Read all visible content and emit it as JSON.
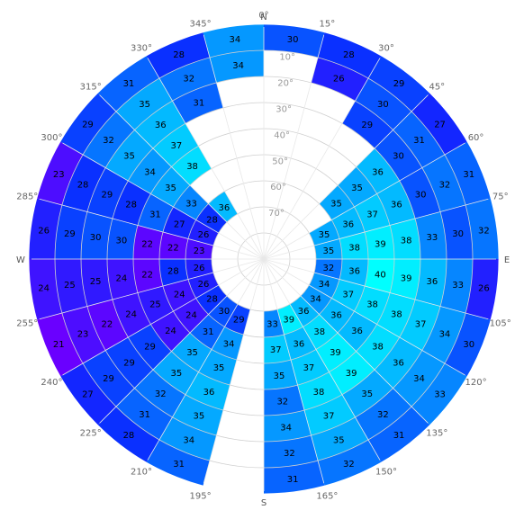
{
  "chart_data": {
    "type": "heatmap",
    "projection": "polar",
    "azimuth_step_deg": 15,
    "elevation_step_deg": 10,
    "compass_labels": {
      "N": "N",
      "E": "E",
      "S": "S",
      "W": "W"
    },
    "azimuth_labels": [
      "0°",
      "15°",
      "30°",
      "45°",
      "60°",
      "75°",
      "105°",
      "120°",
      "135°",
      "150°",
      "165°",
      "195°",
      "210°",
      "225°",
      "240°",
      "255°",
      "285°",
      "300°",
      "315°",
      "330°",
      "345°"
    ],
    "elevation_labels": [
      "10°",
      "20°",
      "30°",
      "40°",
      "50°",
      "60°",
      "70°"
    ],
    "colors": {
      "low": "#6a00ff",
      "mid": "#0a2aff",
      "high": "#00ffff"
    },
    "value_range": [
      21,
      40
    ],
    "obstructed_cells": [
      {
        "az": 0,
        "el": 10
      },
      {
        "az": 0,
        "el": 20
      },
      {
        "az": 0,
        "el": 30
      },
      {
        "az": 0,
        "el": 40
      },
      {
        "az": 0,
        "el": 50
      },
      {
        "az": 0,
        "el": 60
      },
      {
        "az": 15,
        "el": 20
      },
      {
        "az": 15,
        "el": 30
      },
      {
        "az": 15,
        "el": 40
      },
      {
        "az": 15,
        "el": 50
      },
      {
        "az": 15,
        "el": 60
      },
      {
        "az": 30,
        "el": 40
      },
      {
        "az": 30,
        "el": 50
      },
      {
        "az": 30,
        "el": 60
      },
      {
        "az": 315,
        "el": 50
      },
      {
        "az": 315,
        "el": 60
      },
      {
        "az": 330,
        "el": 30
      },
      {
        "az": 330,
        "el": 40
      },
      {
        "az": 330,
        "el": 50
      },
      {
        "az": 330,
        "el": 60
      },
      {
        "az": 345,
        "el": 20
      },
      {
        "az": 345,
        "el": 30
      },
      {
        "az": 345,
        "el": 40
      },
      {
        "az": 345,
        "el": 50
      },
      {
        "az": 345,
        "el": 60
      }
    ],
    "cells": [
      {
        "az": 0,
        "el": 0,
        "v": 30
      },
      {
        "az": 15,
        "el": 0,
        "v": 28
      },
      {
        "az": 15,
        "el": 10,
        "v": 26
      },
      {
        "az": 30,
        "el": 0,
        "v": 29
      },
      {
        "az": 30,
        "el": 10,
        "v": 30
      },
      {
        "az": 30,
        "el": 20,
        "v": 29
      },
      {
        "az": 45,
        "el": 0,
        "v": 27
      },
      {
        "az": 45,
        "el": 10,
        "v": 31
      },
      {
        "az": 45,
        "el": 20,
        "v": 30
      },
      {
        "az": 45,
        "el": 30,
        "v": 36
      },
      {
        "az": 45,
        "el": 40,
        "v": 35
      },
      {
        "az": 45,
        "el": 50,
        "v": 35
      },
      {
        "az": 60,
        "el": 0,
        "v": 31
      },
      {
        "az": 60,
        "el": 10,
        "v": 32
      },
      {
        "az": 60,
        "el": 20,
        "v": 30
      },
      {
        "az": 60,
        "el": 30,
        "v": 36
      },
      {
        "az": 60,
        "el": 40,
        "v": 37
      },
      {
        "az": 60,
        "el": 50,
        "v": 36
      },
      {
        "az": 60,
        "el": 60,
        "v": 35
      },
      {
        "az": 75,
        "el": 0,
        "v": 32
      },
      {
        "az": 75,
        "el": 10,
        "v": 30
      },
      {
        "az": 75,
        "el": 20,
        "v": 33
      },
      {
        "az": 75,
        "el": 30,
        "v": 38
      },
      {
        "az": 75,
        "el": 40,
        "v": 39
      },
      {
        "az": 75,
        "el": 50,
        "v": 38
      },
      {
        "az": 75,
        "el": 60,
        "v": 35
      },
      {
        "az": 90,
        "el": 0,
        "v": 26
      },
      {
        "az": 90,
        "el": 10,
        "v": 33
      },
      {
        "az": 90,
        "el": 20,
        "v": 36
      },
      {
        "az": 90,
        "el": 30,
        "v": 39
      },
      {
        "az": 90,
        "el": 40,
        "v": 40
      },
      {
        "az": 90,
        "el": 50,
        "v": 36
      },
      {
        "az": 90,
        "el": 60,
        "v": 32
      },
      {
        "az": 105,
        "el": 0,
        "v": 30
      },
      {
        "az": 105,
        "el": 10,
        "v": 34
      },
      {
        "az": 105,
        "el": 20,
        "v": 37
      },
      {
        "az": 105,
        "el": 30,
        "v": 38
      },
      {
        "az": 105,
        "el": 40,
        "v": 38
      },
      {
        "az": 105,
        "el": 50,
        "v": 37
      },
      {
        "az": 105,
        "el": 60,
        "v": 34
      },
      {
        "az": 120,
        "el": 0,
        "v": 33
      },
      {
        "az": 120,
        "el": 10,
        "v": 34
      },
      {
        "az": 120,
        "el": 20,
        "v": 36
      },
      {
        "az": 120,
        "el": 30,
        "v": 38
      },
      {
        "az": 120,
        "el": 40,
        "v": 36
      },
      {
        "az": 120,
        "el": 50,
        "v": 36
      },
      {
        "az": 120,
        "el": 60,
        "v": 34
      },
      {
        "az": 135,
        "el": 0,
        "v": 31
      },
      {
        "az": 135,
        "el": 10,
        "v": 32
      },
      {
        "az": 135,
        "el": 20,
        "v": 35
      },
      {
        "az": 135,
        "el": 30,
        "v": 39
      },
      {
        "az": 135,
        "el": 40,
        "v": 39
      },
      {
        "az": 135,
        "el": 50,
        "v": 38
      },
      {
        "az": 135,
        "el": 60,
        "v": 36
      },
      {
        "az": 150,
        "el": 0,
        "v": 32
      },
      {
        "az": 150,
        "el": 10,
        "v": 35
      },
      {
        "az": 150,
        "el": 20,
        "v": 37
      },
      {
        "az": 150,
        "el": 30,
        "v": 38
      },
      {
        "az": 150,
        "el": 40,
        "v": 37
      },
      {
        "az": 150,
        "el": 50,
        "v": 36
      },
      {
        "az": 150,
        "el": 60,
        "v": 39
      },
      {
        "az": 165,
        "el": 0,
        "v": 31
      },
      {
        "az": 165,
        "el": 10,
        "v": 32
      },
      {
        "az": 165,
        "el": 20,
        "v": 34
      },
      {
        "az": 165,
        "el": 30,
        "v": 32
      },
      {
        "az": 165,
        "el": 40,
        "v": 35
      },
      {
        "az": 165,
        "el": 50,
        "v": 37
      },
      {
        "az": 165,
        "el": 60,
        "v": 33
      },
      {
        "az": 195,
        "el": 0,
        "v": 31
      },
      {
        "az": 195,
        "el": 10,
        "v": 34
      },
      {
        "az": 195,
        "el": 20,
        "v": 35
      },
      {
        "az": 195,
        "el": 30,
        "v": 36
      },
      {
        "az": 195,
        "el": 40,
        "v": 35
      },
      {
        "az": 195,
        "el": 50,
        "v": 34
      },
      {
        "az": 195,
        "el": 60,
        "v": 29
      },
      {
        "az": 210,
        "el": 0,
        "v": 28
      },
      {
        "az": 210,
        "el": 10,
        "v": 31
      },
      {
        "az": 210,
        "el": 20,
        "v": 32
      },
      {
        "az": 210,
        "el": 30,
        "v": 35
      },
      {
        "az": 210,
        "el": 40,
        "v": 35
      },
      {
        "az": 210,
        "el": 50,
        "v": 31
      },
      {
        "az": 210,
        "el": 60,
        "v": 30
      },
      {
        "az": 225,
        "el": 0,
        "v": 27
      },
      {
        "az": 225,
        "el": 10,
        "v": 29
      },
      {
        "az": 225,
        "el": 20,
        "v": 29
      },
      {
        "az": 225,
        "el": 30,
        "v": 29
      },
      {
        "az": 225,
        "el": 40,
        "v": 24
      },
      {
        "az": 225,
        "el": 50,
        "v": 24
      },
      {
        "az": 225,
        "el": 60,
        "v": 28
      },
      {
        "az": 240,
        "el": 0,
        "v": 21
      },
      {
        "az": 240,
        "el": 10,
        "v": 23
      },
      {
        "az": 240,
        "el": 20,
        "v": 22
      },
      {
        "az": 240,
        "el": 30,
        "v": 24
      },
      {
        "az": 240,
        "el": 40,
        "v": 25
      },
      {
        "az": 240,
        "el": 50,
        "v": 24
      },
      {
        "az": 240,
        "el": 60,
        "v": 26
      },
      {
        "az": 255,
        "el": 0,
        "v": 24
      },
      {
        "az": 255,
        "el": 10,
        "v": 25
      },
      {
        "az": 255,
        "el": 20,
        "v": 25
      },
      {
        "az": 255,
        "el": 30,
        "v": 24
      },
      {
        "az": 255,
        "el": 40,
        "v": 22
      },
      {
        "az": 255,
        "el": 50,
        "v": 28
      },
      {
        "az": 255,
        "el": 60,
        "v": 26
      },
      {
        "az": 270,
        "el": 0,
        "v": 26
      },
      {
        "az": 270,
        "el": 10,
        "v": 29
      },
      {
        "az": 270,
        "el": 20,
        "v": 30
      },
      {
        "az": 270,
        "el": 30,
        "v": 30
      },
      {
        "az": 270,
        "el": 40,
        "v": 22
      },
      {
        "az": 270,
        "el": 50,
        "v": 22
      },
      {
        "az": 270,
        "el": 60,
        "v": 23
      },
      {
        "az": 285,
        "el": 0,
        "v": 23
      },
      {
        "az": 285,
        "el": 10,
        "v": 28
      },
      {
        "az": 285,
        "el": 20,
        "v": 29
      },
      {
        "az": 285,
        "el": 30,
        "v": 28
      },
      {
        "az": 285,
        "el": 40,
        "v": 31
      },
      {
        "az": 285,
        "el": 50,
        "v": 27
      },
      {
        "az": 285,
        "el": 60,
        "v": 26
      },
      {
        "az": 300,
        "el": 0,
        "v": 29
      },
      {
        "az": 300,
        "el": 10,
        "v": 32
      },
      {
        "az": 300,
        "el": 20,
        "v": 35
      },
      {
        "az": 300,
        "el": 30,
        "v": 34
      },
      {
        "az": 300,
        "el": 40,
        "v": 35
      },
      {
        "az": 300,
        "el": 50,
        "v": 33
      },
      {
        "az": 300,
        "el": 60,
        "v": 28
      },
      {
        "az": 315,
        "el": 0,
        "v": 31
      },
      {
        "az": 315,
        "el": 10,
        "v": 35
      },
      {
        "az": 315,
        "el": 20,
        "v": 36
      },
      {
        "az": 315,
        "el": 30,
        "v": 37
      },
      {
        "az": 315,
        "el": 40,
        "v": 38
      },
      {
        "az": 315,
        "el": 60,
        "v": 36
      },
      {
        "az": 330,
        "el": 0,
        "v": 28
      },
      {
        "az": 330,
        "el": 10,
        "v": 32
      },
      {
        "az": 330,
        "el": 20,
        "v": 31
      },
      {
        "az": 345,
        "el": 0,
        "v": 34
      },
      {
        "az": 345,
        "el": 10,
        "v": 34
      }
    ]
  }
}
